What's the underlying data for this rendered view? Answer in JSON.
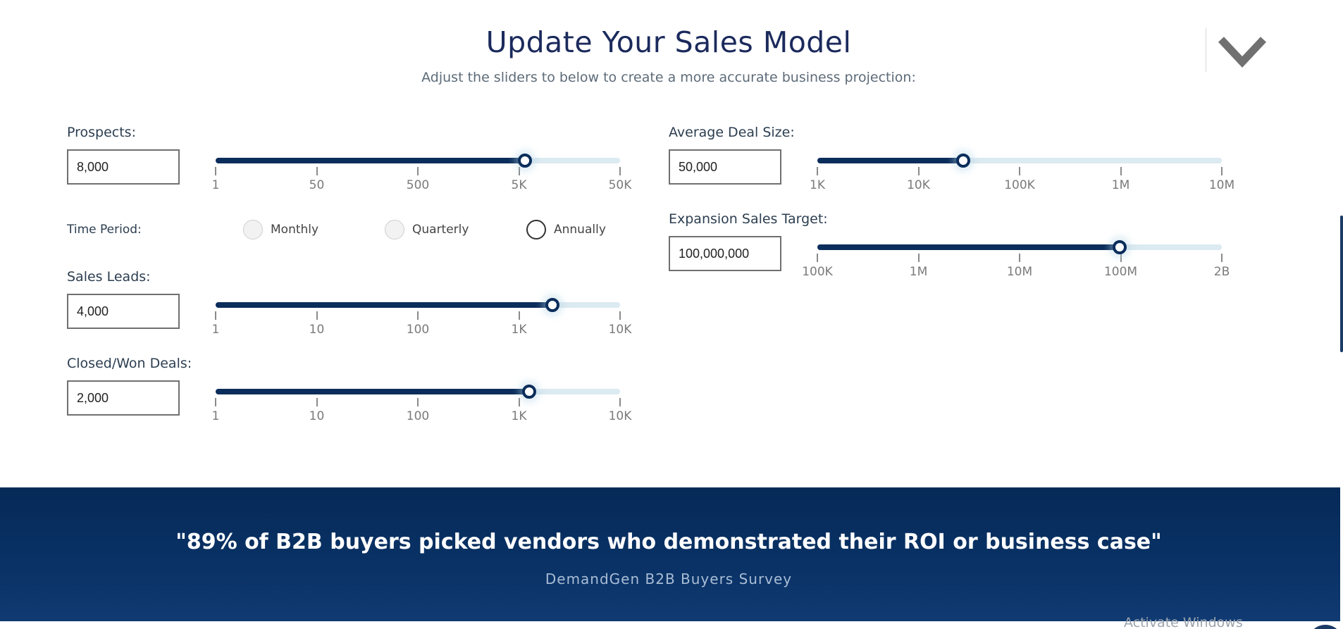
{
  "header": {
    "title": "Update Your Sales Model",
    "subtitle": "Adjust the sliders to below to create a more accurate business projection:"
  },
  "collapse": {
    "icon": "chevron-down-icon"
  },
  "prospects": {
    "label": "Prospects:",
    "value": "8,000",
    "slider": {
      "fraction": 0.765,
      "ticks": [
        "1",
        "50",
        "500",
        "5K",
        "50K"
      ]
    }
  },
  "time_period": {
    "label": "Time Period:",
    "options": [
      {
        "label": "Monthly",
        "selected": false
      },
      {
        "label": "Quarterly",
        "selected": false
      },
      {
        "label": "Annually",
        "selected": true
      }
    ]
  },
  "sales_leads": {
    "label": "Sales Leads:",
    "value": "4,000",
    "slider": {
      "fraction": 0.832,
      "ticks": [
        "1",
        "10",
        "100",
        "1K",
        "10K"
      ]
    }
  },
  "closed_won": {
    "label": "Closed/Won Deals:",
    "value": "2,000",
    "slider": {
      "fraction": 0.776,
      "ticks": [
        "1",
        "10",
        "100",
        "1K",
        "10K"
      ]
    }
  },
  "avg_deal_size": {
    "label": "Average Deal Size:",
    "value": "50,000",
    "slider": {
      "fraction": 0.36,
      "ticks": [
        "1K",
        "10K",
        "100K",
        "1M",
        "10M"
      ]
    }
  },
  "expansion_target": {
    "label": "Expansion Sales Target:",
    "value": "100,000,000",
    "slider": {
      "fraction": 0.748,
      "ticks": [
        "100K",
        "1M",
        "10M",
        "100M",
        "2B"
      ]
    }
  },
  "banner": {
    "quote": "\"89% of B2B buyers picked vendors who demonstrated their ROI or business case\"",
    "source": "DemandGen B2B Buyers Survey"
  },
  "os_overlay": {
    "text": "Activate Windows"
  },
  "colors": {
    "navy": "#0b2d5b",
    "track": "#dceaf1",
    "banner": "#062a58",
    "title": "#1b2a5c"
  }
}
